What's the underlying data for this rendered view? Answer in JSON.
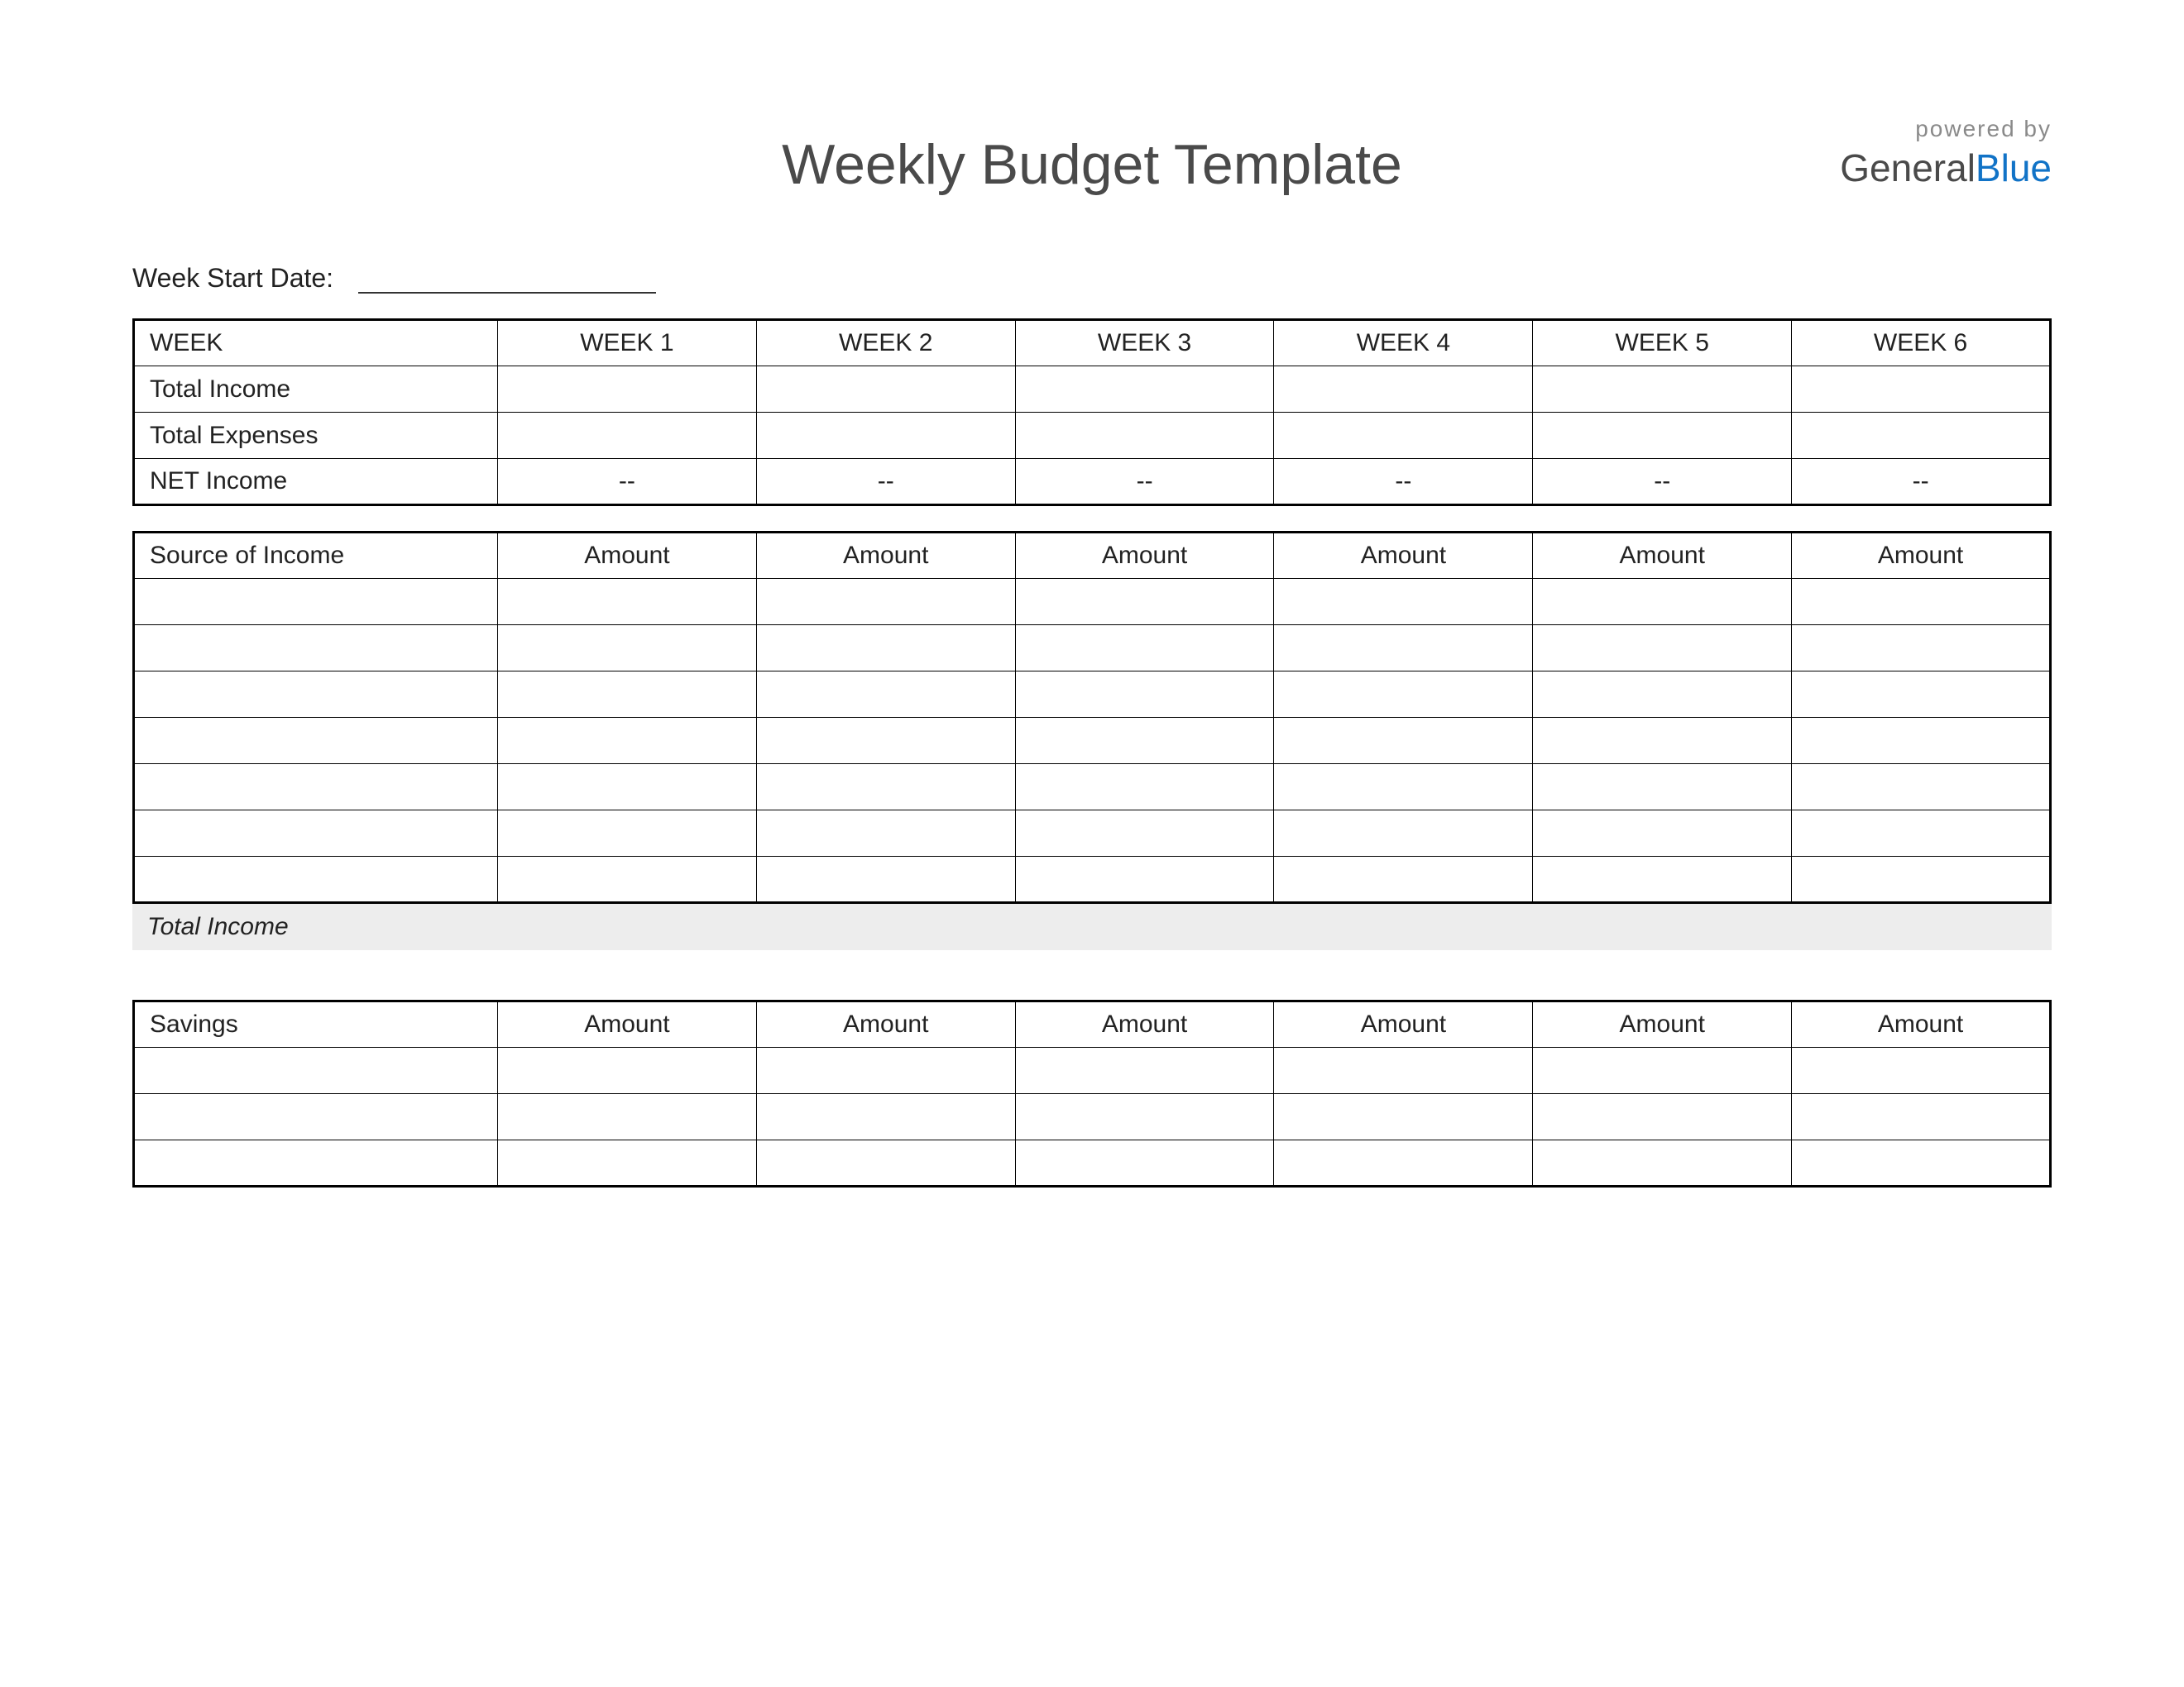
{
  "header": {
    "title": "Weekly Budget Template",
    "powered_by": "powered by",
    "brand_part1": "General",
    "brand_part2": "Blue"
  },
  "start_date": {
    "label": "Week Start Date:",
    "value": ""
  },
  "summary_table": {
    "headers": [
      "WEEK",
      "WEEK 1",
      "WEEK 2",
      "WEEK 3",
      "WEEK 4",
      "WEEK 5",
      "WEEK 6"
    ],
    "rows": [
      {
        "label": "Total Income",
        "values": [
          "",
          "",
          "",
          "",
          "",
          ""
        ]
      },
      {
        "label": "Total Expenses",
        "values": [
          "",
          "",
          "",
          "",
          "",
          ""
        ]
      },
      {
        "label": "NET Income",
        "values": [
          "--",
          "--",
          "--",
          "--",
          "--",
          "--"
        ]
      }
    ]
  },
  "income_table": {
    "headers": [
      "Source of Income",
      "Amount",
      "Amount",
      "Amount",
      "Amount",
      "Amount",
      "Amount"
    ],
    "blank_rows": 7,
    "total_label": "Total Income"
  },
  "savings_table": {
    "headers": [
      "Savings",
      "Amount",
      "Amount",
      "Amount",
      "Amount",
      "Amount",
      "Amount"
    ],
    "blank_rows": 3
  }
}
